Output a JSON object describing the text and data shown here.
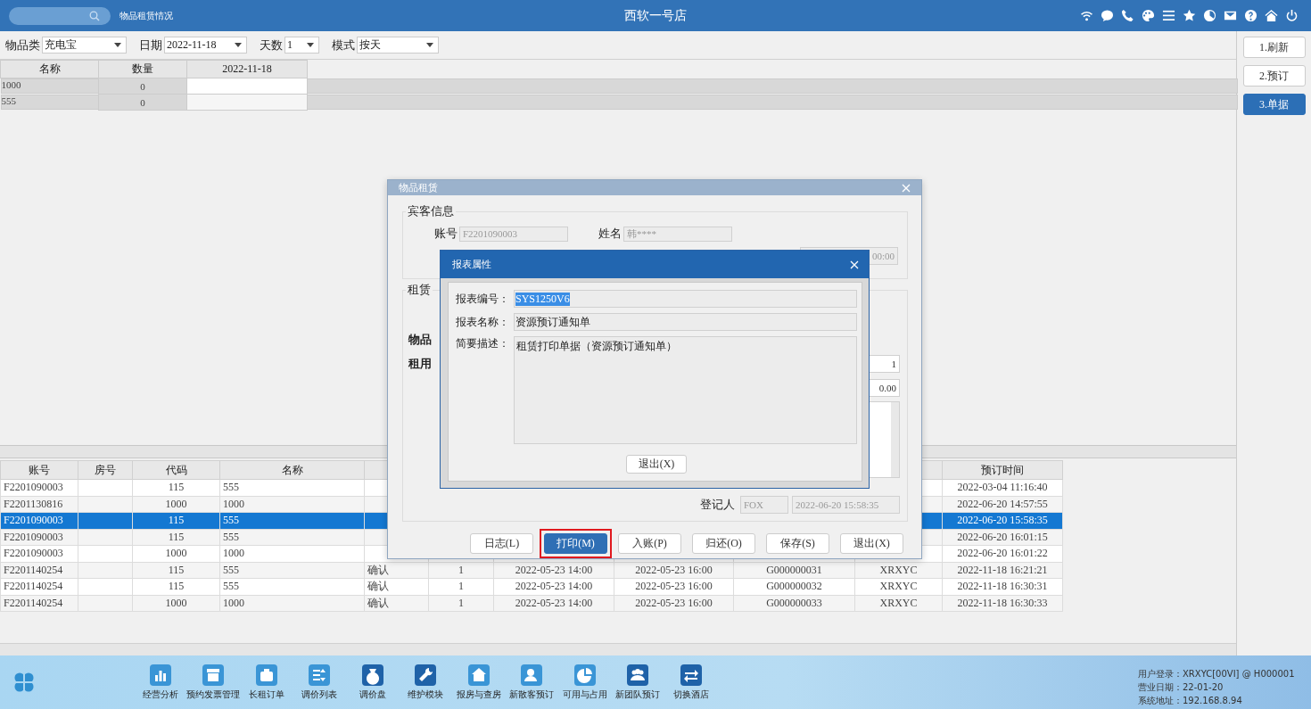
{
  "header": {
    "page_title": "物品租赁情况",
    "store": "西软一号店"
  },
  "filters": [
    {
      "label": "物品类",
      "value": "充电宝"
    },
    {
      "label": "日期",
      "value": "2022-11-18"
    },
    {
      "label": "天数",
      "value": "1"
    },
    {
      "label": "模式",
      "value": "按天"
    }
  ],
  "stock_grid": {
    "columns": [
      "名称",
      "数量",
      "2022-11-18"
    ],
    "rows": [
      {
        "name": "1000",
        "qty": "0"
      },
      {
        "name": "555",
        "qty": "0"
      }
    ]
  },
  "side_buttons": [
    {
      "label": "1.刷新",
      "selected": false
    },
    {
      "label": "2.预订",
      "selected": false
    },
    {
      "label": "3.单据",
      "selected": true
    }
  ],
  "bookings": {
    "columns": {
      "account": "账号",
      "room": "房号",
      "code": "代码",
      "name": "名称",
      "booked": "预订时间"
    },
    "rows": [
      {
        "selected": false,
        "account": "F2201090003",
        "code": "115",
        "name": "555",
        "booked": "2022-03-04 11:16:40"
      },
      {
        "selected": false,
        "account": "F2201130816",
        "code": "1000",
        "name": "1000",
        "booked": "2022-06-20 14:57:55"
      },
      {
        "selected": true,
        "account": "F2201090003",
        "code": "115",
        "name": "555",
        "booked": "2022-06-20 15:58:35"
      },
      {
        "selected": false,
        "account": "F2201090003",
        "code": "115",
        "name": "555",
        "booked": "2022-06-20 16:01:15"
      },
      {
        "selected": false,
        "account": "F2201090003",
        "code": "1000",
        "name": "1000",
        "booked": "2022-06-20 16:01:22"
      },
      {
        "selected": false,
        "account": "F2201140254",
        "code": "115",
        "name": "555",
        "status": "确认",
        "qty": "1",
        "start": "2022-05-23 14:00",
        "end": "2022-05-23 16:00",
        "ref": "G000000031",
        "user": "XRXYC",
        "booked": "2022-11-18 16:21:21"
      },
      {
        "selected": false,
        "account": "F2201140254",
        "code": "115",
        "name": "555",
        "status": "确认",
        "qty": "1",
        "start": "2022-05-23 14:00",
        "end": "2022-05-23 16:00",
        "ref": "G000000032",
        "user": "XRXYC",
        "booked": "2022-11-18 16:30:31"
      },
      {
        "selected": false,
        "account": "F2201140254",
        "code": "1000",
        "name": "1000",
        "status": "确认",
        "qty": "1",
        "start": "2022-05-23 14:00",
        "end": "2022-05-23 16:00",
        "ref": "G000000033",
        "user": "XRXYC",
        "booked": "2022-11-18 16:30:33"
      }
    ]
  },
  "rental_dialog": {
    "title": "物品租赁",
    "guest_group": "宾客信息",
    "account_label": "账号",
    "account": "F2201090003",
    "name_label": "姓名",
    "name": "韩****",
    "time_tail": "00:00",
    "rent_group": "租赁",
    "labels": [
      {
        "text": "物品",
        "bold": true
      },
      {
        "text": "租用",
        "bold": true,
        "value": "1"
      },
      {
        "value": "0.00"
      }
    ],
    "clerk_label": "登记人",
    "clerk": "FOX",
    "clerk_time": "2022-06-20 15:58:35",
    "buttons": [
      {
        "label": "日志(L)",
        "selected": false,
        "marked": false
      },
      {
        "label": "打印(M)",
        "selected": true,
        "marked": true
      },
      {
        "label": "入账(P)",
        "selected": false,
        "marked": false
      },
      {
        "label": "归还(O)",
        "selected": false,
        "marked": false
      },
      {
        "label": "保存(S)",
        "selected": false,
        "marked": false
      },
      {
        "label": "退出(X)",
        "selected": false,
        "marked": false
      }
    ]
  },
  "report_dialog": {
    "title": "报表属性",
    "fields": [
      {
        "label": "报表编号：",
        "value": "SYS1250V6",
        "text_selected": true
      },
      {
        "label": "报表名称：",
        "value": "资源预订通知单",
        "text_selected": false
      }
    ],
    "description_label": "简要描述：",
    "description": "租赁打印单据（资源预订通知单）",
    "exit_button": "退出(X)"
  },
  "taskbar": {
    "items": [
      "经营分析",
      "预约发票管理",
      "长租订单",
      "调价列表",
      "调价盘",
      "维护模块",
      "报房与查房",
      "新散客预订",
      "可用与占用",
      "新团队预订",
      "切换酒店"
    ],
    "info": [
      "用户登录：XRXYC[00VI] @ H000001",
      "营业日期：22-01-20",
      "系统地址：192.168.8.94"
    ]
  }
}
